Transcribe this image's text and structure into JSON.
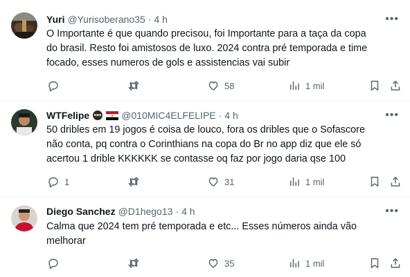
{
  "tweets": [
    {
      "name": "Yuri",
      "handle": "@Yurisoberano35",
      "dot": "·",
      "time": "4 h",
      "more": "•••",
      "text_lines": [
        "O Importante é que quando precisou, foi Importante para a taça da copa",
        "do brasil. Resto foi amistosos de luxo. 2024 contra pré temporada e time",
        "focado, esses numeros de gols e assistencias vai subir"
      ],
      "replies": "",
      "retweets": "",
      "likes": "58",
      "views": "1 mil"
    },
    {
      "name": "WTFelipe",
      "handle": "@010MIC4ELFELIPE",
      "dot": "·",
      "time": "4 h",
      "more": "•••",
      "badge_icons": [
        "ninja-emoji-icon",
        "egypt-flag-icon"
      ],
      "text_lines": [
        "50 dribles em 19 jogos é coisa de louco, fora os dribles que o Sofascore",
        "não conta, pq contra o Corinthians na copa do Br no app diz que ele só",
        "acertou 1 drible KKKKKK se contasse oq faz por jogo daria qse 100"
      ],
      "replies": "1",
      "retweets": "",
      "likes": "31",
      "views": "1 mil"
    },
    {
      "name": "Diego Sanchez",
      "handle": "@D1hego13",
      "dot": "·",
      "time": "4 h",
      "more": "•••",
      "text_lines": [
        "Calma que 2024 tem pré temporada e etc... Esses números ainda vão",
        "melhorar"
      ],
      "replies": "",
      "retweets": "",
      "likes": "35",
      "views": "1 mil"
    }
  ],
  "colors": {
    "text": "#0f1419",
    "secondary": "#536471",
    "divider": "#eff3f4"
  }
}
